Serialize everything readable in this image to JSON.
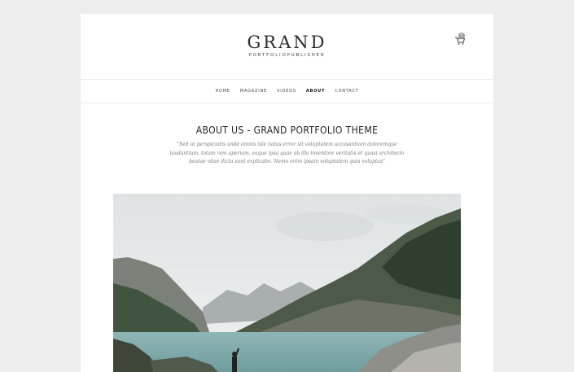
{
  "site": {
    "title": "GRAND",
    "subtitle": "PORTFOLIOPUBLISHER",
    "cart_count": "0"
  },
  "nav": {
    "items": [
      {
        "label": "HOME",
        "active": false
      },
      {
        "label": "MAGAZINE",
        "active": false
      },
      {
        "label": "VIDEOS",
        "active": false
      },
      {
        "label": "ABOUT",
        "active": true
      },
      {
        "label": "CONTACT",
        "active": false
      }
    ]
  },
  "page": {
    "title": "ABOUT US - GRAND PORTFOLIO THEME",
    "intro": "\"Sed ut perspiciatis unde omnis iste natus error sit voluptatem accusantium doloremque laudantium, totam rem aperiam, eaque ipsa quae ab illo inventore veritatis et quasi architecto beatae vitae dicta sunt explicabo. Nemo enim ipsam voluptatem quia voluptas\""
  },
  "icons": {
    "cart": "shopping-cart-icon"
  },
  "colors": {
    "background": "#ededed",
    "page": "#ffffff",
    "text": "#222222",
    "muted": "#777777"
  }
}
